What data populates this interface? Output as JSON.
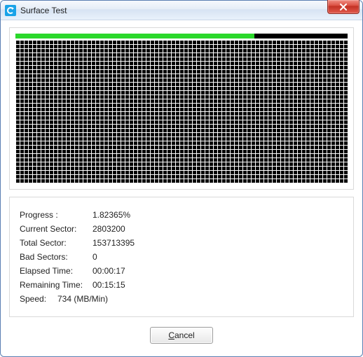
{
  "window": {
    "title": "Surface Test"
  },
  "progress": {
    "percent_done": 1.82365,
    "strip_done_width_pct": 72
  },
  "stats": {
    "progress_label": "Progress :",
    "progress_value": "1.82365%",
    "current_sector_label": "Current Sector:",
    "current_sector_value": "2803200",
    "total_sector_label": "Total Sector:",
    "total_sector_value": "153713395",
    "bad_sectors_label": "Bad Sectors:",
    "bad_sectors_value": "0",
    "elapsed_label": "Elapsed Time:",
    "elapsed_value": "00:00:17",
    "remaining_label": "Remaining Time:",
    "remaining_value": "00:15:15",
    "speed_label": "Speed:",
    "speed_value": "734 (MB/Min)"
  },
  "buttons": {
    "cancel_prefix": "C",
    "cancel_rest": "ancel"
  }
}
